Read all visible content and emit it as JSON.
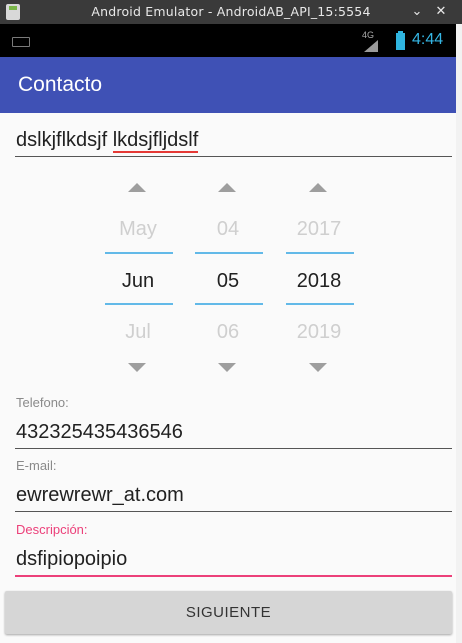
{
  "window": {
    "title": "Android Emulator - AndroidAB_API_15:5554",
    "minimize_glyph": "⌄",
    "close_glyph": "✕"
  },
  "statusbar": {
    "network": "4G",
    "clock": "4:44",
    "battery_color": "#2fb5e0"
  },
  "appbar": {
    "title": "Contacto",
    "color": "#3f51b5"
  },
  "form": {
    "name_word1": "dslkjflkdsjf",
    "name_word2": "lkdsjfljdslf",
    "date": {
      "month": {
        "prev": "May",
        "current": "Jun",
        "next": "Jul"
      },
      "day": {
        "prev": "04",
        "current": "05",
        "next": "06"
      },
      "year": {
        "prev": "2017",
        "current": "2018",
        "next": "2019"
      }
    },
    "telefono": {
      "label": "Telefono:",
      "value": "432325435436546"
    },
    "email": {
      "label": "E-mail:",
      "value": "ewrewrewr_at.com"
    },
    "descripcion": {
      "label": "Descripción:",
      "value": "dsfipiopoipio",
      "focus_color": "#ec407a"
    },
    "submit_label": "SIGUIENTE"
  }
}
